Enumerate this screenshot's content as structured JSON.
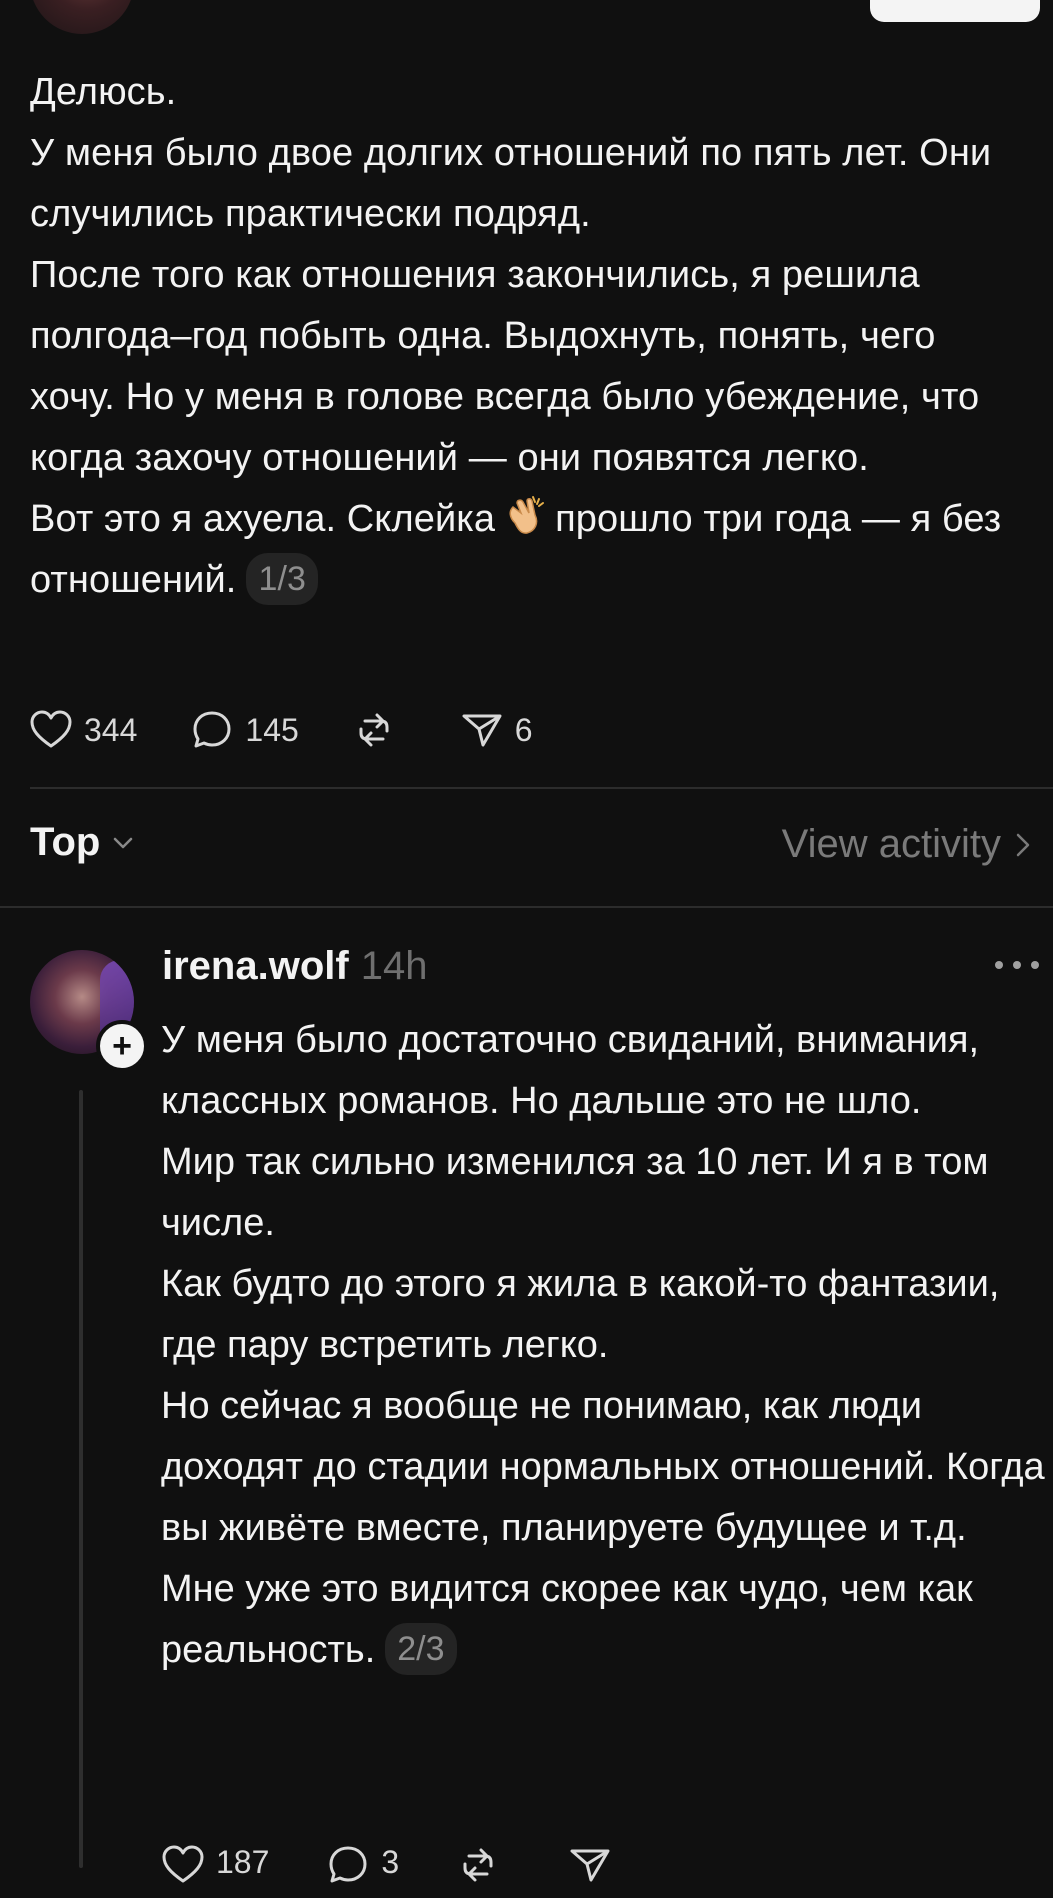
{
  "post": {
    "paragraphs": [
      "Делюсь.",
      "У меня было двое долгих отношений по пять лет. Они случились практически подряд.",
      "После того как отношения закончились, я решила полгода–год побыть одна. Выдохнуть, понять, чего хочу. Но у меня в голове всегда было убеждение, что когда захочу отношений — они появятся легко."
    ],
    "last_line_before": "Вот это я ахуела. Склейка",
    "last_line_after": "прошло три года — я без отношений.",
    "emoji": "clapping-hands",
    "page": "1/3",
    "likes": "344",
    "comments": "145",
    "shares": "6"
  },
  "sort": {
    "label": "Top"
  },
  "view_activity": {
    "label": "View activity"
  },
  "reply": {
    "username": "irena.wolf",
    "time": "14h",
    "paragraphs": [
      "У меня было достаточно свиданий, внимания, классных романов. Но дальше это не шло.",
      "Мир так сильно изменился за 10 лет. И я в том числе.",
      "Как будто до этого я жила в какой-то фантазии, где пару встретить легко.",
      "Но сейчас я вообще не понимаю, как люди доходят до стадии нормальных отношений. Когда вы живёте вместе, планируете будущее и т.д."
    ],
    "last_line": "Мне уже это видится скорее как чудо, чем как реальность.",
    "page": "2/3",
    "likes": "187",
    "comments": "3"
  },
  "colors": {
    "background": "#101010",
    "text": "#f3f3f3",
    "muted": "#7a7a7a"
  }
}
